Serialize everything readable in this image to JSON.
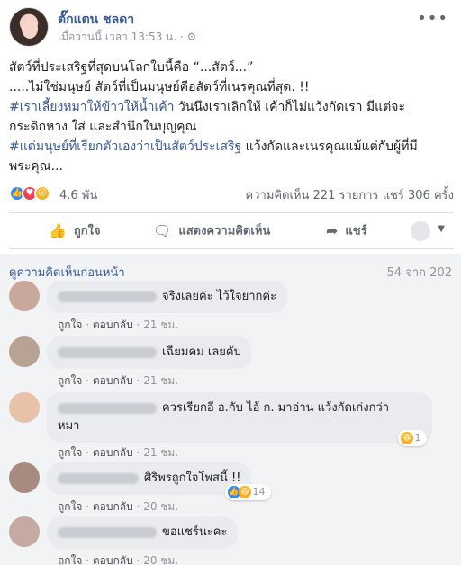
{
  "post": {
    "author": "ตั๊กแตน ชลดา",
    "time": "เมื่อวานนี้ เวลา 13:53 น.",
    "more_icon": "more-icon",
    "lines": {
      "l1": "สัตว์ที่ประเสริฐที่สุดบนโลกใบนี้คือ “...สัตว์...”",
      "l2": ".....ไม่ใช่มนุษย์ สัตว์ที่เป็นมนุษย์คือสัตว์ที่เนรคุณที่สุด. !!",
      "tag1": "#เราเลี้ยงหมาให้ข้าวให้น้ำเค้า",
      "l3a": " วันนึงเราเลิกให้ เค้าก็ไม่แว้งกัดเรา มีแต่จะ",
      "l3b": "กระดิกหาง ใส่ และสำนึกในบุญคุณ",
      "tag2": "#แต่มนุษย์ที่เรียกตัวเองว่าเป็นสัตว์ประเสริฐ",
      "l4a": " แว้งกัดและเนรคุณแม้แต่กับผู้ที่มี",
      "l4b": "พระคุณ..."
    },
    "reactions": {
      "count": "4.6 พัน",
      "types": [
        "like",
        "love",
        "wow"
      ]
    },
    "stats_right": "ความคิดเห็น 221 รายการ  แชร์ 306 ครั้ง",
    "actions": {
      "like": "ถูกใจ",
      "comment": "แสดงความคิดเห็น",
      "share": "แชร์"
    }
  },
  "comments_header": {
    "previous": "ดูความคิดเห็นก่อนหน้า",
    "count": "54 จาก 202"
  },
  "comments": [
    {
      "text": "จริงเลยค่ะ ไว้ใจยากค่ะ",
      "like": "ถูกใจ",
      "reply": "ตอบกลับ",
      "time": "21 ชม."
    },
    {
      "text": "เฉียมคม เลยคับ",
      "like": "ถูกใจ",
      "reply": "ตอบกลับ",
      "time": "21 ชม."
    },
    {
      "text1": "ควรเรียกอี อ.กับ ไอ้ ก. มาอ่าน แว้งกัดเก่งกว่า",
      "text2": "หมา",
      "like": "ถูกใจ",
      "reply": "ตอบกลับ",
      "time": "21 ชม.",
      "react_count": "1"
    },
    {
      "text": "ศิริพรถูกใจโพสนี้ !!",
      "like": "ถูกใจ",
      "reply": "ตอบกลับ",
      "time": "20 ชม.",
      "react_count": "14"
    },
    {
      "text": "ขอแชร์นะคะ",
      "like": "ถูกใจ",
      "reply": "ตอบกลับ",
      "time": "20 ชม."
    }
  ],
  "colors": {
    "link": "#365899",
    "bubble": "#e9ebee",
    "muted": "#90949c",
    "background": "#f2f3f5"
  }
}
